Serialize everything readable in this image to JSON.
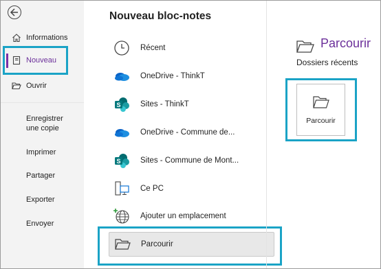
{
  "nav": {
    "items": [
      {
        "label": "Informations",
        "icon": "home-icon"
      },
      {
        "label": "Nouveau",
        "icon": "notebook-icon"
      },
      {
        "label": "Ouvrir",
        "icon": "folder-open-icon"
      }
    ],
    "secondary": [
      "Enregistrer une copie",
      "Imprimer",
      "Partager",
      "Exporter",
      "Envoyer"
    ],
    "accent": "#6b2f9a",
    "highlight": "#1aa3c6"
  },
  "main": {
    "title": "Nouveau bloc-notes",
    "locations": [
      {
        "label": "Récent",
        "icon": "clock-icon"
      },
      {
        "label": "OneDrive - ThinkT",
        "icon": "onedrive-icon"
      },
      {
        "label": "Sites - ThinkT",
        "icon": "sharepoint-icon"
      },
      {
        "label": "OneDrive - Commune de...",
        "icon": "onedrive-icon"
      },
      {
        "label": "Sites - Commune de Mont...",
        "icon": "sharepoint-icon"
      },
      {
        "label": "Ce PC",
        "icon": "pc-icon"
      },
      {
        "label": "Ajouter un emplacement",
        "icon": "globe-add-icon"
      },
      {
        "label": "Parcourir",
        "icon": "folder-open-icon"
      }
    ]
  },
  "right": {
    "title": "Parcourir",
    "subtitle": "Dossiers récents",
    "card_label": "Parcourir"
  }
}
